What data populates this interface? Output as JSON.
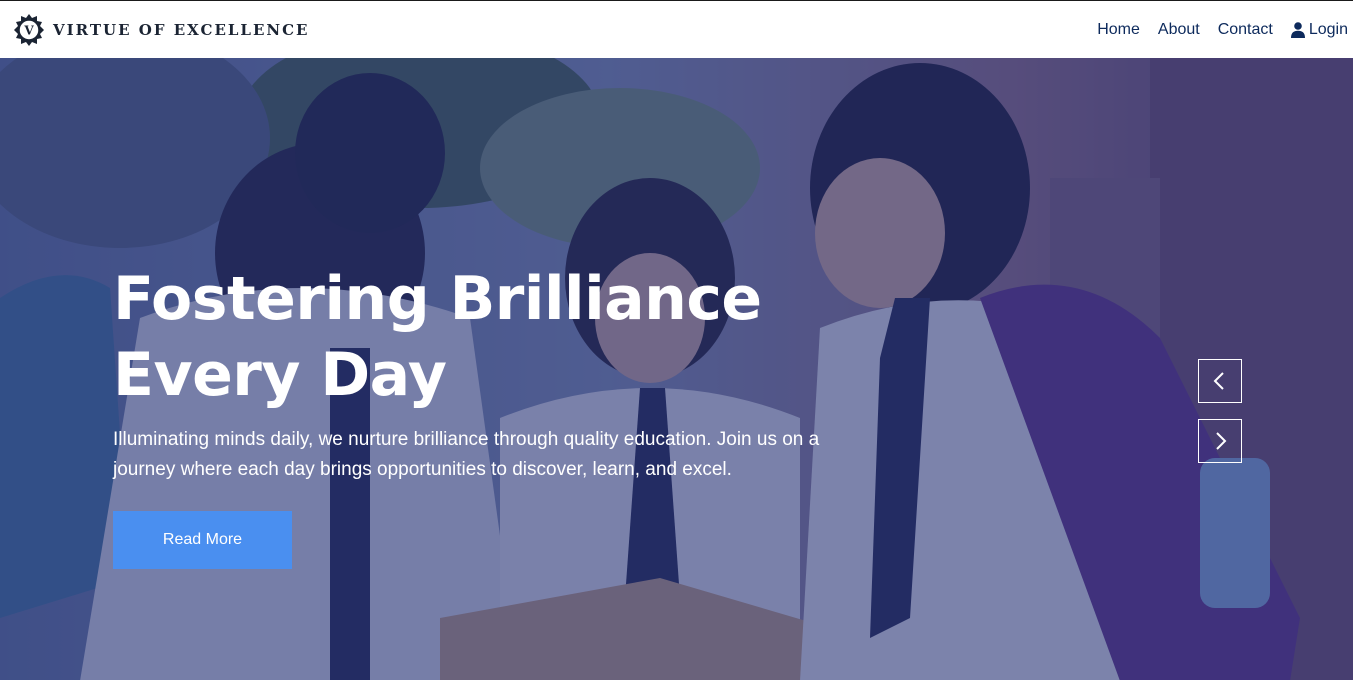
{
  "brand": {
    "name": "VIRTUE OF EXCELLENCE",
    "emblem_letter": "V",
    "emblem_icon": "crest-logo"
  },
  "nav": {
    "items": [
      {
        "label": "Home"
      },
      {
        "label": "About"
      },
      {
        "label": "Contact"
      },
      {
        "label": "Login",
        "icon": "user-icon"
      }
    ]
  },
  "hero": {
    "title_line1": "Fostering Brilliance",
    "title_line2": "Every Day",
    "subtitle": "Illuminating minds daily, we nurture brilliance through quality education. Join us on a journey where each day brings opportunities to discover, learn, and excel.",
    "button_label": "Read More",
    "prev_icon": "chevron-left-icon",
    "next_icon": "chevron-right-icon"
  },
  "colors": {
    "nav_text": "#0d2a5c",
    "brand_text": "#1b2433",
    "overlay": "#1e286e",
    "button_bg": "#4a8ff0",
    "hero_text": "#ffffff"
  }
}
